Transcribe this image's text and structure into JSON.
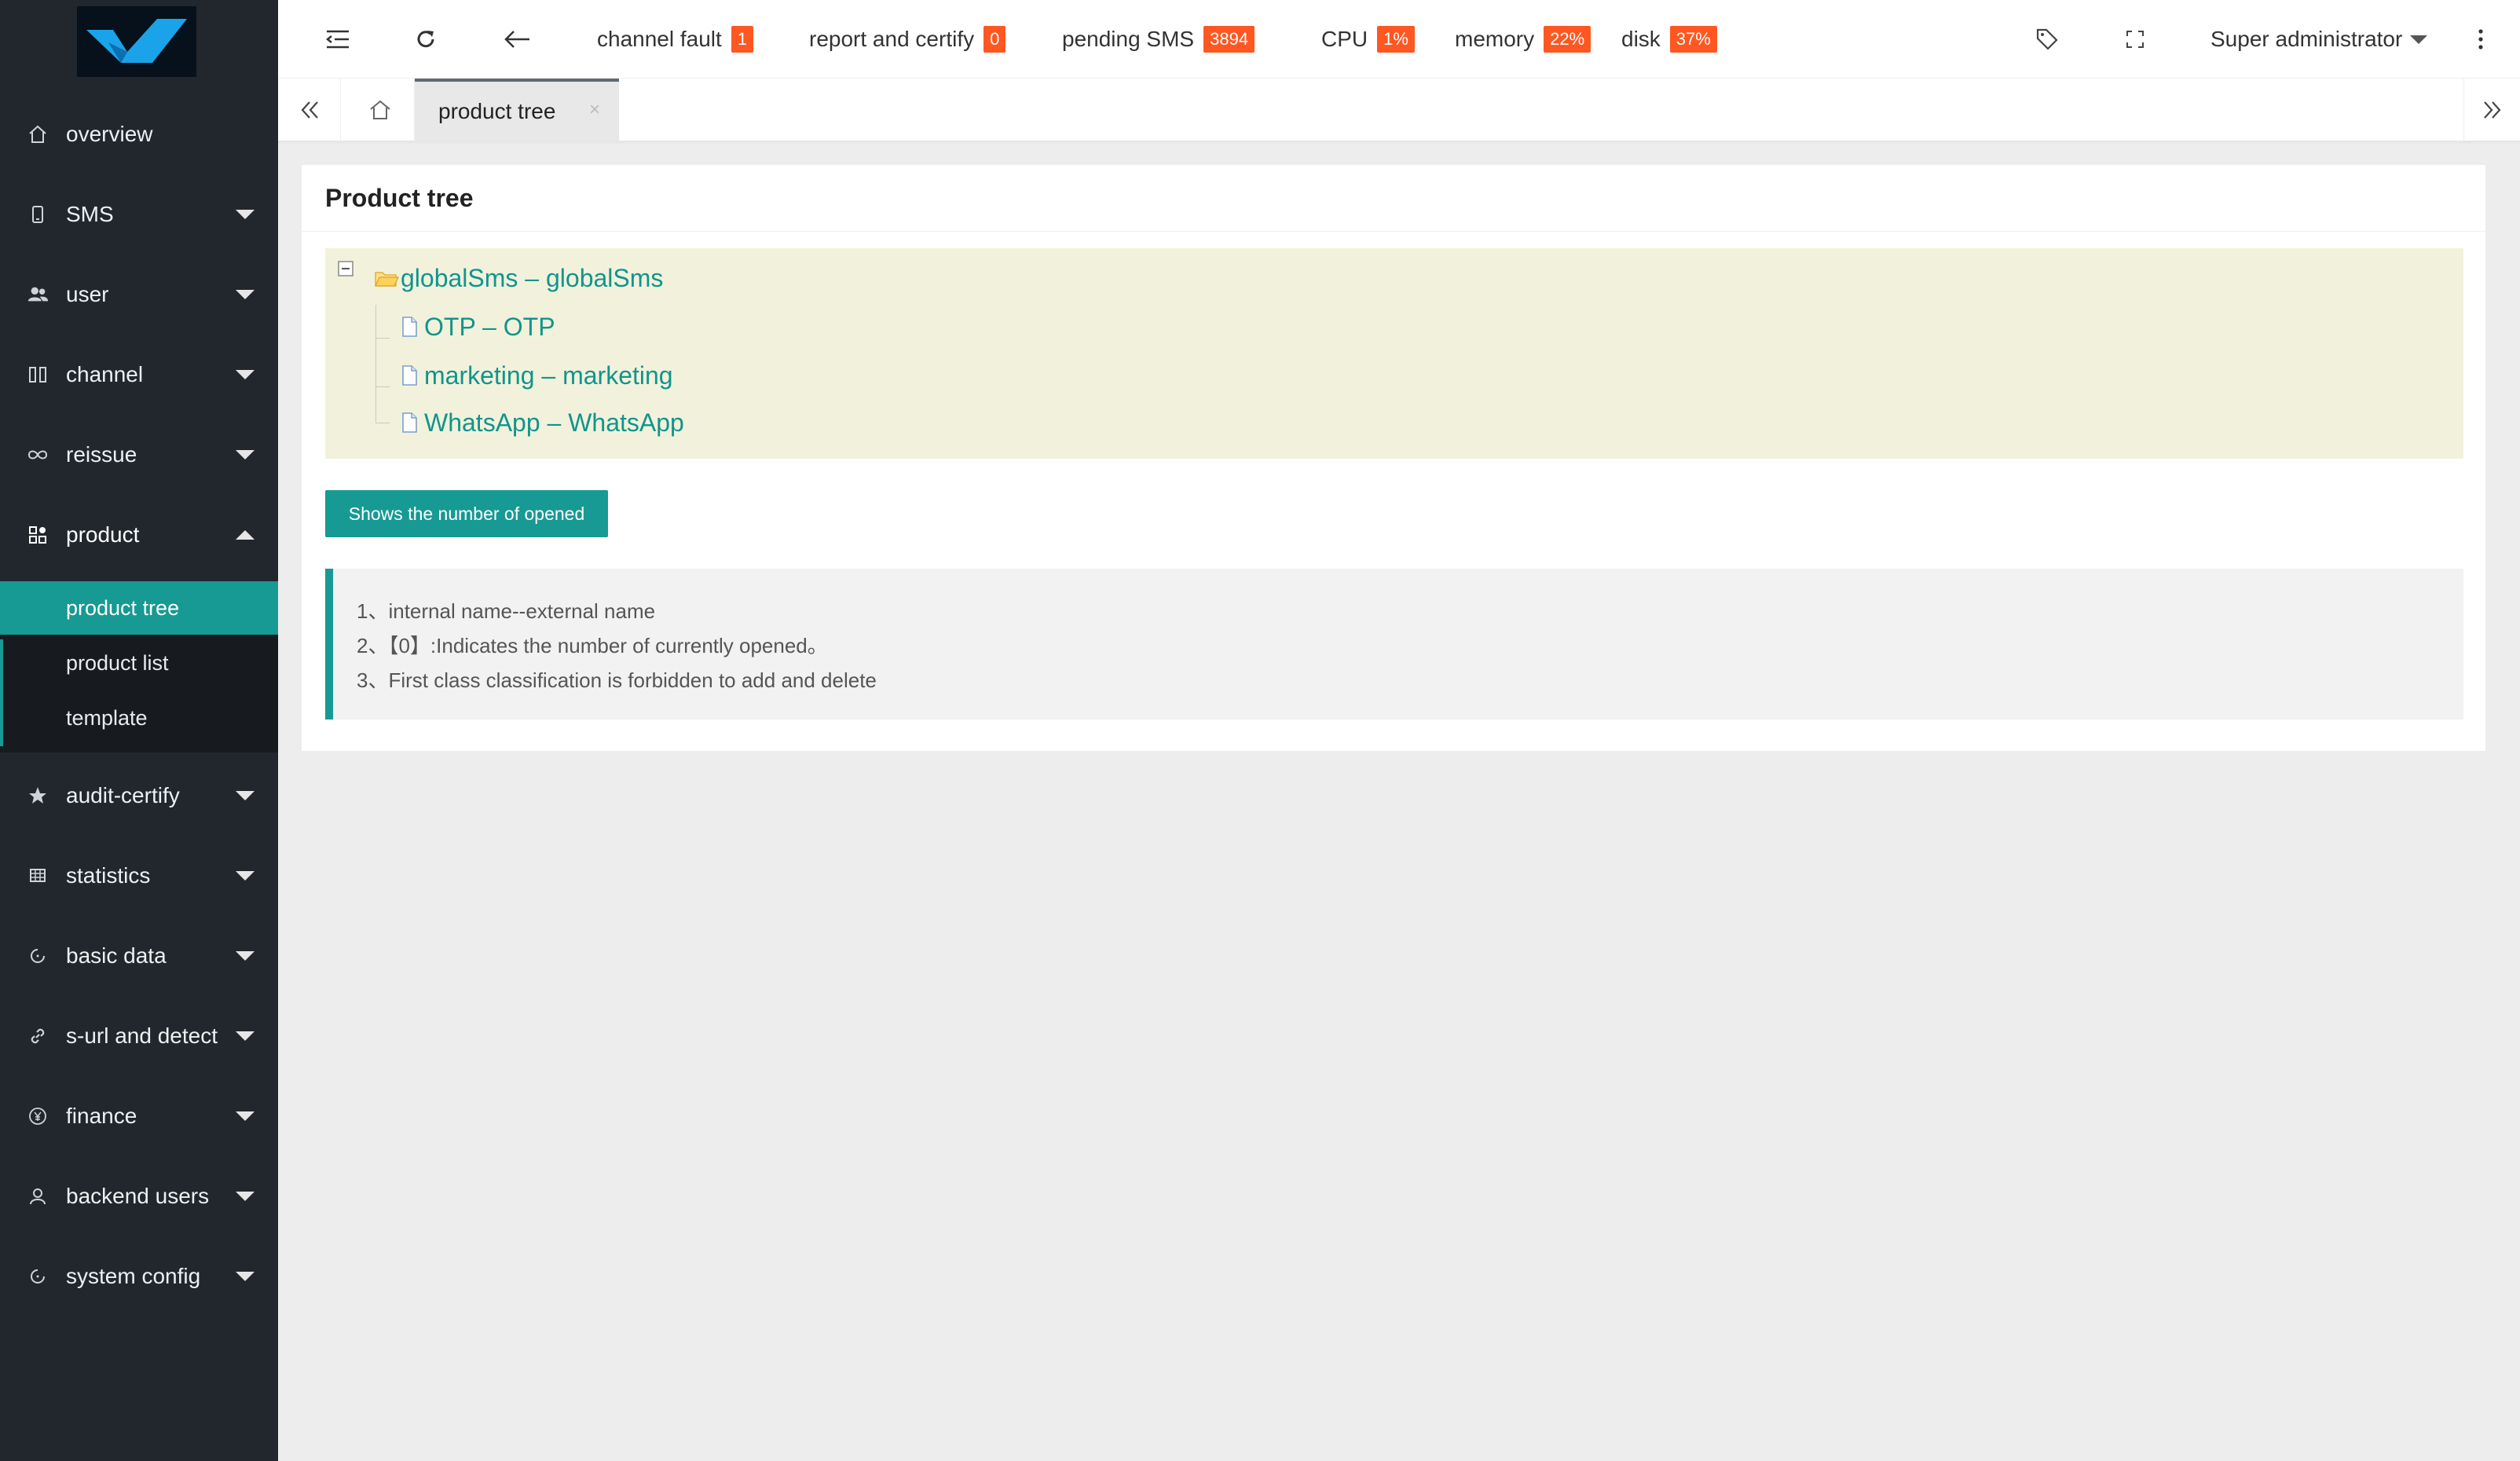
{
  "sidebar": {
    "items": [
      {
        "label": "overview",
        "icon": "home-icon",
        "caret": "none"
      },
      {
        "label": "SMS",
        "icon": "phone-icon",
        "caret": "down"
      },
      {
        "label": "user",
        "icon": "users-icon",
        "caret": "down"
      },
      {
        "label": "channel",
        "icon": "columns-icon",
        "caret": "down"
      },
      {
        "label": "reissue",
        "icon": "infinity-icon",
        "caret": "down"
      },
      {
        "label": "product",
        "icon": "grid-plus-icon",
        "caret": "up"
      },
      {
        "label": "audit-certify",
        "icon": "star-icon",
        "caret": "down"
      },
      {
        "label": "statistics",
        "icon": "table-icon",
        "caret": "down"
      },
      {
        "label": "basic data",
        "icon": "refresh-icon",
        "caret": "down"
      },
      {
        "label": "s-url and detect",
        "icon": "link-icon",
        "caret": "down"
      },
      {
        "label": "finance",
        "icon": "yen-icon",
        "caret": "down"
      },
      {
        "label": "backend users",
        "icon": "user-icon",
        "caret": "down"
      },
      {
        "label": "system config",
        "icon": "settings-icon",
        "caret": "down"
      }
    ],
    "submenu": [
      {
        "label": "product tree",
        "active": true
      },
      {
        "label": "product list",
        "active": false
      },
      {
        "label": "template",
        "active": false
      }
    ]
  },
  "header": {
    "stats": [
      {
        "label": "channel fault",
        "value": "1"
      },
      {
        "label": "report and certify",
        "value": "0"
      },
      {
        "label": "pending SMS",
        "value": "3894"
      },
      {
        "label": "CPU",
        "value": "1%"
      },
      {
        "label": "memory",
        "value": "22%"
      },
      {
        "label": "disk",
        "value": "37%"
      }
    ],
    "user": "Super administrator",
    "badge_color": "#ff5722"
  },
  "tabs": {
    "active_label": "product tree",
    "close_glyph": "×"
  },
  "main": {
    "title": "Product tree",
    "tree": {
      "root": "globalSms – globalSms",
      "children": [
        "OTP – OTP",
        "marketing – marketing",
        "WhatsApp – WhatsApp"
      ]
    },
    "button_label": "Shows the number of opened",
    "notes": [
      "1、internal name--external name",
      "2、【0】:Indicates the number of currently opened。",
      "3、First class classification is forbidden to add and delete"
    ]
  },
  "colors": {
    "accent": "#169a93",
    "sidebar_bg": "#22272e",
    "tree_bg": "#f2f2dc"
  }
}
